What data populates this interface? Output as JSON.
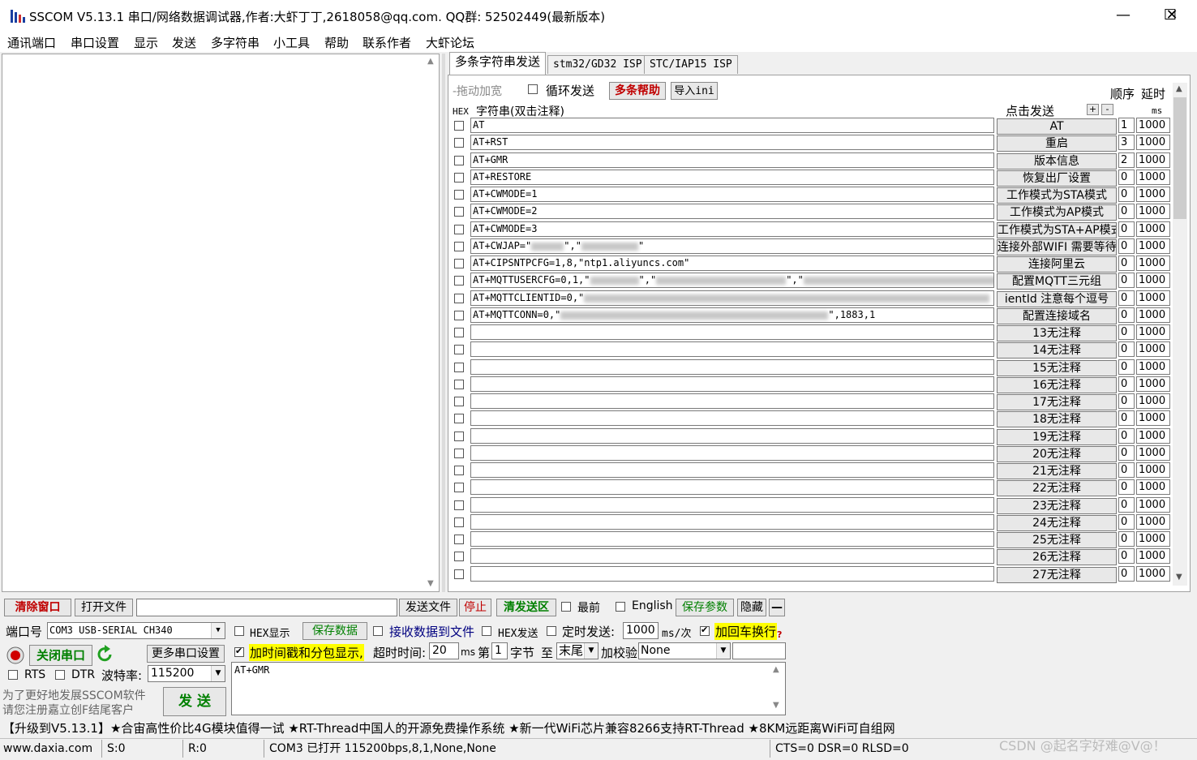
{
  "window": {
    "title": "SSCOM V5.13.1 串口/网络数据调试器,作者:大虾丁丁,2618058@qq.com. QQ群: 52502449(最新版本)",
    "minimize": "—",
    "maximize": "☐",
    "close": "✕"
  },
  "menu": [
    "通讯端口",
    "串口设置",
    "显示",
    "发送",
    "多字符串",
    "小工具",
    "帮助",
    "联系作者",
    "大虾论坛"
  ],
  "tabs": [
    "多条字符串发送",
    "stm32/GD32 ISP",
    "STC/IAP15 ISP"
  ],
  "multi": {
    "drag_label": "-拖动加宽",
    "loop_label": "循环发送",
    "help_label": "多条帮助",
    "import_label": "导入ini",
    "order_label": "顺序",
    "delay_label": "延时",
    "hex_label": "HEX",
    "string_label": "字符串(双击注释)",
    "click_send_label": "点击发送",
    "plus": "+",
    "minus": "-",
    "ms_label": "ms"
  },
  "rows": [
    {
      "cmd": "AT",
      "btn": "AT",
      "order": "1",
      "delay": "1000"
    },
    {
      "cmd": "AT+RST",
      "btn": "重启",
      "order": "3",
      "delay": "1000"
    },
    {
      "cmd": "AT+GMR",
      "btn": "版本信息",
      "order": "2",
      "delay": "1000"
    },
    {
      "cmd": "AT+RESTORE",
      "btn": "恢复出厂设置",
      "order": "0",
      "delay": "1000"
    },
    {
      "cmd": "AT+CWMODE=1",
      "btn": "工作模式为STA模式",
      "order": "0",
      "delay": "1000"
    },
    {
      "cmd": "AT+CWMODE=2",
      "btn": "工作模式为AP模式",
      "order": "0",
      "delay": "1000"
    },
    {
      "cmd": "AT+CWMODE=3",
      "btn": "工作模式为STA+AP模式",
      "order": "0",
      "delay": "1000"
    },
    {
      "cmd": "AT+CWJAP=\"",
      "cmd_tail": "\",\"",
      "cmd_end": "\"",
      "btn": "连接外部WIFI  需要等待",
      "order": "0",
      "delay": "1000"
    },
    {
      "cmd": "AT+CIPSNTPCFG=1,8,\"ntp1.aliyuncs.com\"",
      "btn": "连接阿里云",
      "order": "0",
      "delay": "1000"
    },
    {
      "cmd": "AT+MQTTUSERCFG=0,1,\"",
      "cmd_tail": "\",\"",
      "cmd_end": "\",\"",
      "btn": "配置MQTT三元组",
      "order": "0",
      "delay": "1000"
    },
    {
      "cmd": "AT+MQTTCLIENTID=0,\"",
      "btn": "ientId  注意每个逗号",
      "order": "0",
      "delay": "1000"
    },
    {
      "cmd": "AT+MQTTCONN=0,\"",
      "cmd_end": "\",1883,1",
      "btn": "配置连接域名",
      "order": "0",
      "delay": "1000"
    },
    {
      "cmd": "",
      "btn": "13无注释",
      "order": "0",
      "delay": "1000"
    },
    {
      "cmd": "",
      "btn": "14无注释",
      "order": "0",
      "delay": "1000"
    },
    {
      "cmd": "",
      "btn": "15无注释",
      "order": "0",
      "delay": "1000"
    },
    {
      "cmd": "",
      "btn": "16无注释",
      "order": "0",
      "delay": "1000"
    },
    {
      "cmd": "",
      "btn": "17无注释",
      "order": "0",
      "delay": "1000"
    },
    {
      "cmd": "",
      "btn": "18无注释",
      "order": "0",
      "delay": "1000"
    },
    {
      "cmd": "",
      "btn": "19无注释",
      "order": "0",
      "delay": "1000"
    },
    {
      "cmd": "",
      "btn": "20无注释",
      "order": "0",
      "delay": "1000"
    },
    {
      "cmd": "",
      "btn": "21无注释",
      "order": "0",
      "delay": "1000"
    },
    {
      "cmd": "",
      "btn": "22无注释",
      "order": "0",
      "delay": "1000"
    },
    {
      "cmd": "",
      "btn": "23无注释",
      "order": "0",
      "delay": "1000"
    },
    {
      "cmd": "",
      "btn": "24无注释",
      "order": "0",
      "delay": "1000"
    },
    {
      "cmd": "",
      "btn": "25无注释",
      "order": "0",
      "delay": "1000"
    },
    {
      "cmd": "",
      "btn": "26无注释",
      "order": "0",
      "delay": "1000"
    },
    {
      "cmd": "",
      "btn": "27无注释",
      "order": "0",
      "delay": "1000"
    }
  ],
  "toolbar": {
    "clear_label": "清除窗口",
    "open_file_label": "打开文件",
    "send_file_label": "发送文件",
    "stop_label": "停止",
    "clear_send_label": "清发送区",
    "top_label": "最前",
    "english_label": "English",
    "save_params_label": "保存参数",
    "hide_label": "隐藏",
    "collapse": "—"
  },
  "port": {
    "port_label": "端口号",
    "port_value": "COM3 USB-SERIAL CH340",
    "close_port_label": "关闭串口",
    "more_settings_label": "更多串口设置",
    "rts_label": "RTS",
    "dtr_label": "DTR",
    "baud_label": "波特率:",
    "baud_value": "115200",
    "promo_line1": "为了更好地发展SSCOM软件",
    "promo_line2": "请您注册嘉立创F结尾客户",
    "send_label": "发 送"
  },
  "options": {
    "hex_display": "HEX显示",
    "save_data": "保存数据",
    "recv_to_file": "接收数据到文件",
    "hex_send": "HEX发送",
    "timed_send": "定时发送:",
    "timed_value": "1000",
    "ms_per": "ms/次",
    "add_crlf": "加回车换行",
    "timestamp": "加时间戳和分包显示,",
    "timeout_label": "超时时间:",
    "timeout_value": "20",
    "ms": "ms",
    "nth": "第",
    "byte_value": "1",
    "byte_label": "字节",
    "to": "至",
    "tail": "末尾",
    "checksum": "加校验",
    "checksum_value": "None",
    "help_mark": "?"
  },
  "send_text": "AT+GMR",
  "ticker": "【升级到V5.13.1】★合宙高性价比4G模块值得一试 ★RT-Thread中国人的开源免费操作系统 ★新一代WiFi芯片兼容8266支持RT-Thread ★8KM远距离WiFi可自组网",
  "status": {
    "site": "www.daxia.com",
    "sent": "S:0",
    "recv": "R:0",
    "port_state": "COM3 已打开  115200bps,8,1,None,None",
    "lines": "CTS=0 DSR=0 RLSD=0",
    "watermark": "CSDN @起名字好难@V@！"
  },
  "colors": {
    "highlight": "#ffff00",
    "danger": "#c00000",
    "ok": "#008000"
  }
}
